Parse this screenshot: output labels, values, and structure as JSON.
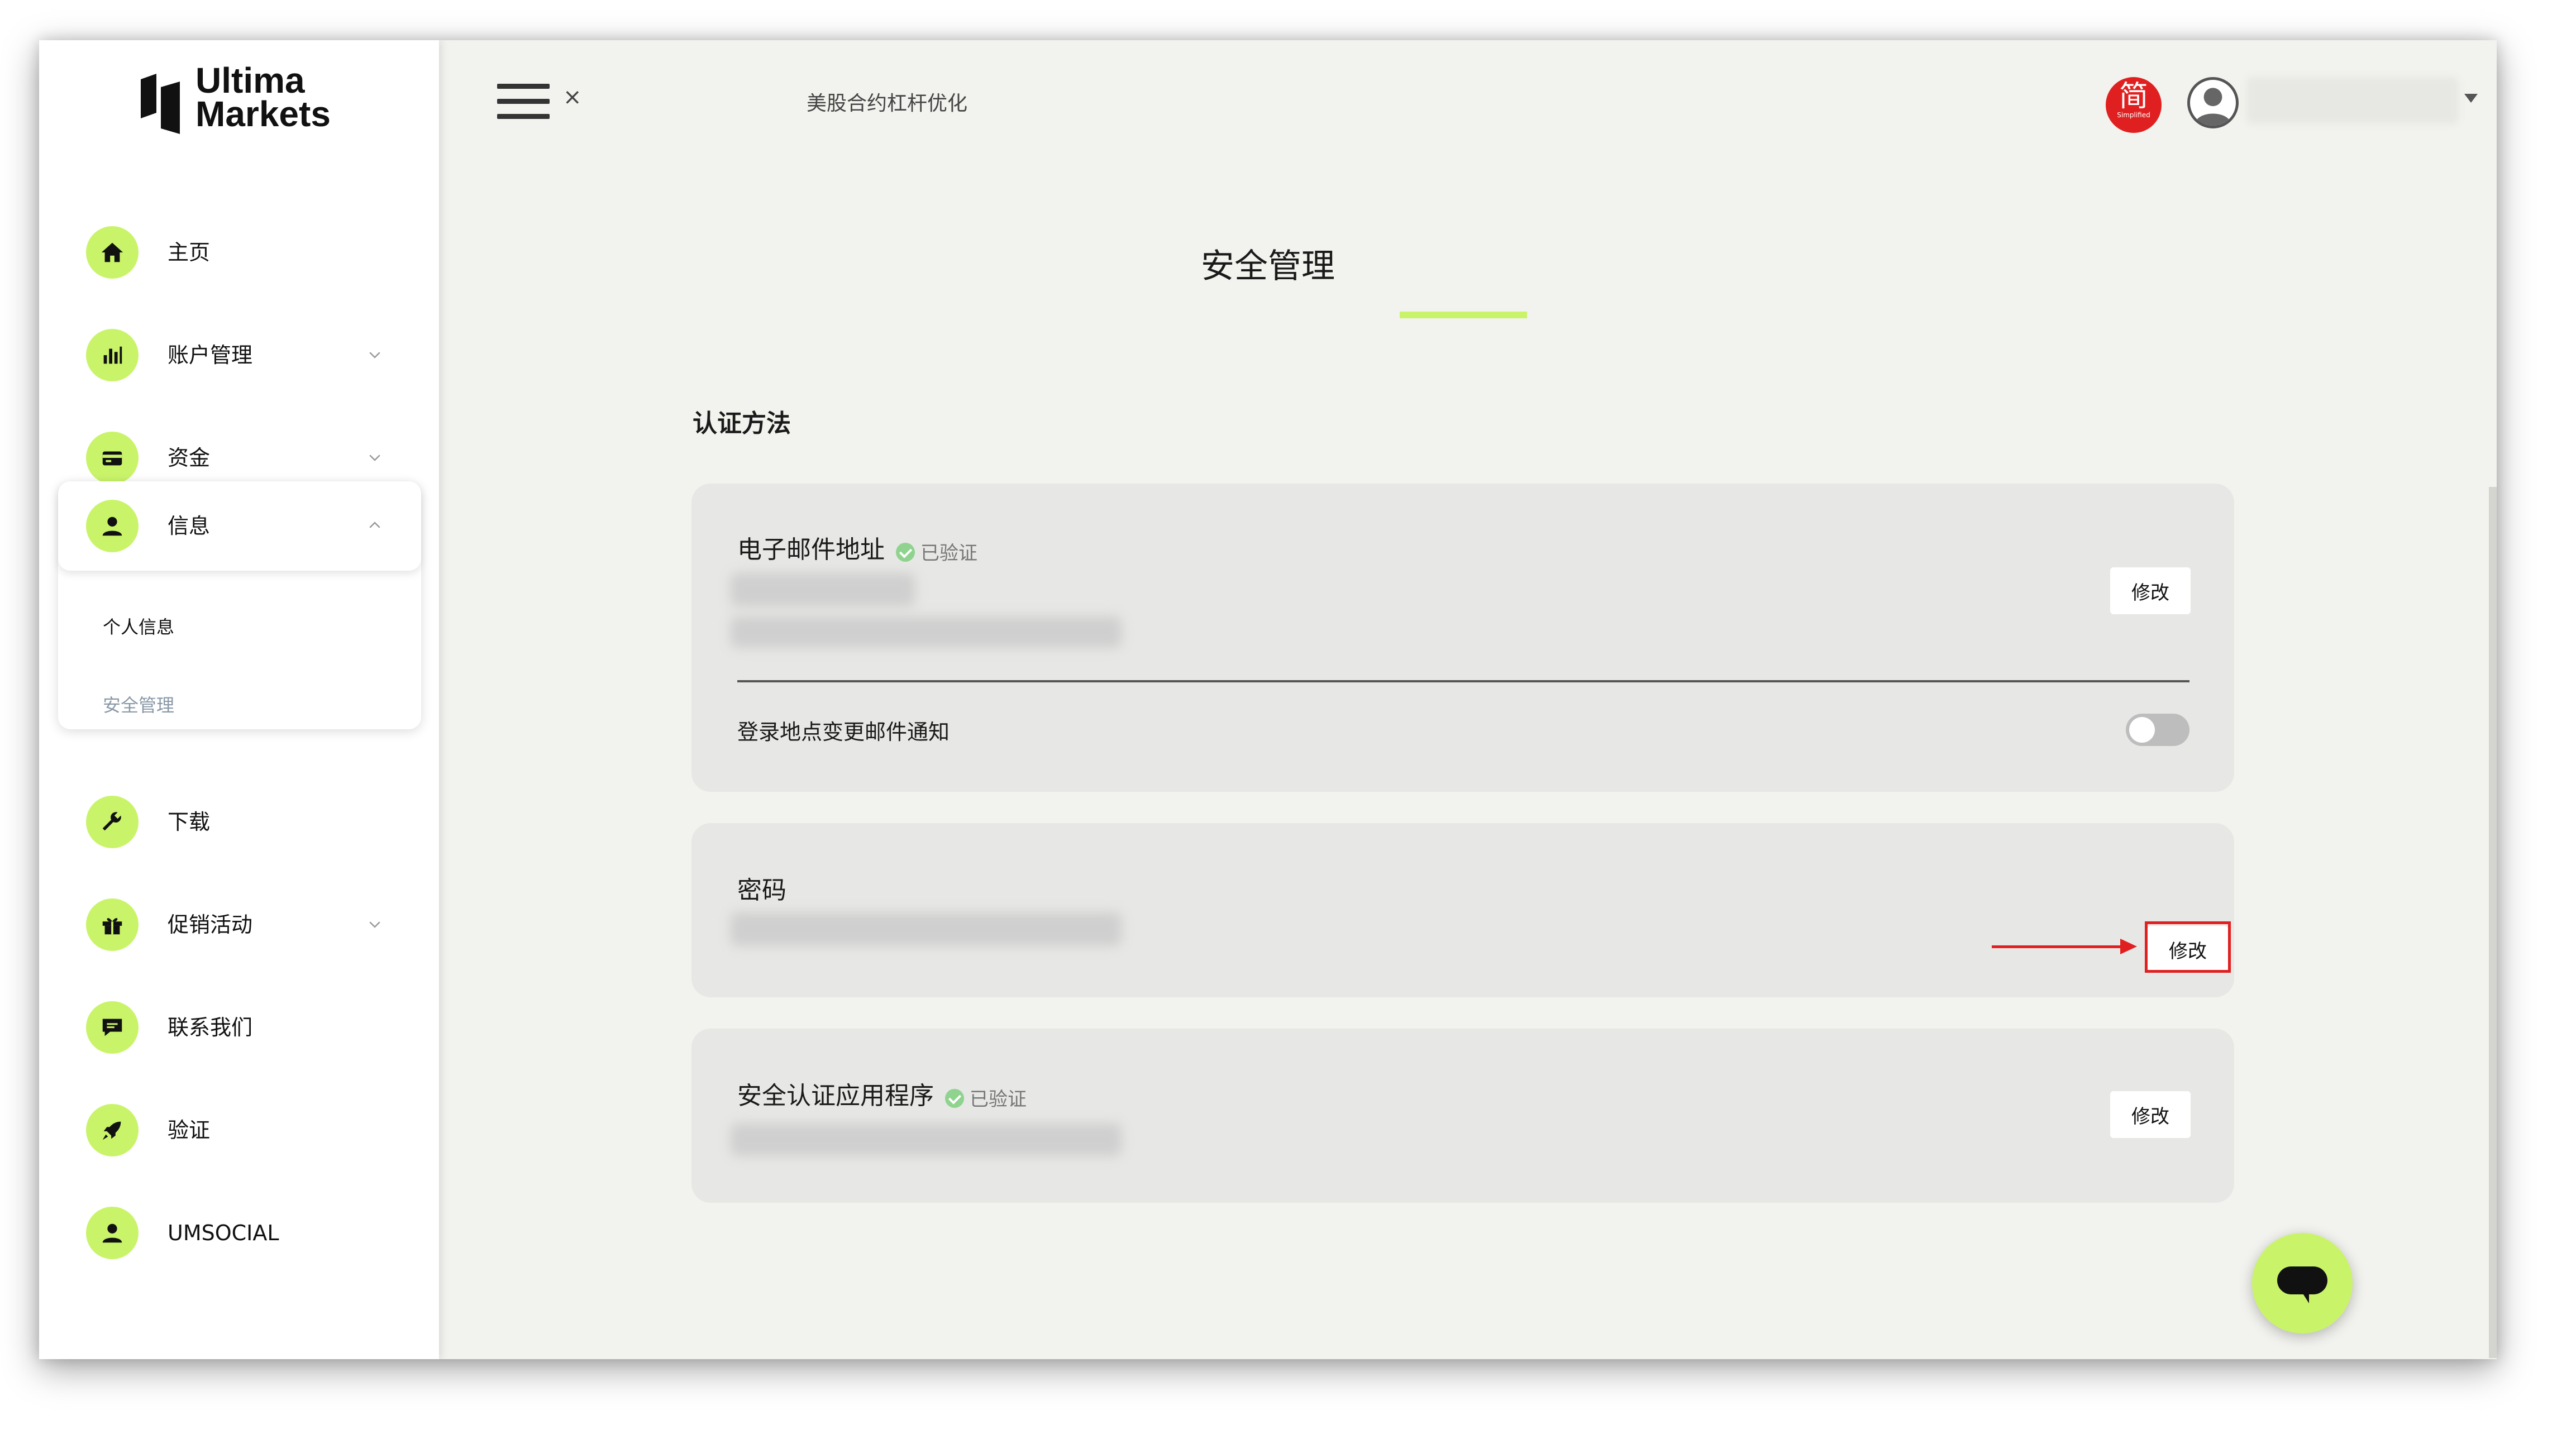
{
  "brand": {
    "logo_line1": "Ultima",
    "logo_line2": "Markets"
  },
  "colors": {
    "accent": "#c9f46a",
    "alert_red": "#e02020",
    "card_bg": "#e7e7e5",
    "page_bg": "#f2f2ee"
  },
  "sidebar": {
    "items": [
      {
        "id": "home",
        "label": "主页",
        "icon": "home-icon"
      },
      {
        "id": "accounts",
        "label": "账户管理",
        "icon": "bar-chart-icon",
        "expandable": true
      },
      {
        "id": "funds",
        "label": "资金",
        "icon": "wallet-icon",
        "expandable": true
      },
      {
        "id": "info",
        "label": "信息",
        "icon": "user-icon",
        "expanded": true
      },
      {
        "id": "download",
        "label": "下载",
        "icon": "wrench-icon"
      },
      {
        "id": "promotions",
        "label": "促销活动",
        "icon": "gift-icon",
        "expandable": true
      },
      {
        "id": "contact",
        "label": "联系我们",
        "icon": "chat-icon"
      },
      {
        "id": "verify",
        "label": "验证",
        "icon": "rocket-icon"
      },
      {
        "id": "umsocial",
        "label": "UMSOCIAL",
        "icon": "user-icon"
      }
    ],
    "info_sub": [
      {
        "label": "个人信息",
        "active": false
      },
      {
        "label": "安全管理",
        "active": true
      }
    ]
  },
  "topbar": {
    "title": "美股合约杠杆优化",
    "close_symbol": "×",
    "language_badge": {
      "char": "简",
      "caption": "Simplified"
    }
  },
  "main": {
    "page_title": "安全管理",
    "section_label": "认证方法",
    "email_card": {
      "title": "电子邮件地址",
      "status": "已验证",
      "modify_label": "修改",
      "notify_label": "登录地点变更邮件通知",
      "notify_enabled": false
    },
    "password_card": {
      "title": "密码",
      "modify_label": "修改"
    },
    "authenticator_card": {
      "title": "安全认证应用程序",
      "status": "已验证",
      "modify_label": "修改"
    }
  }
}
